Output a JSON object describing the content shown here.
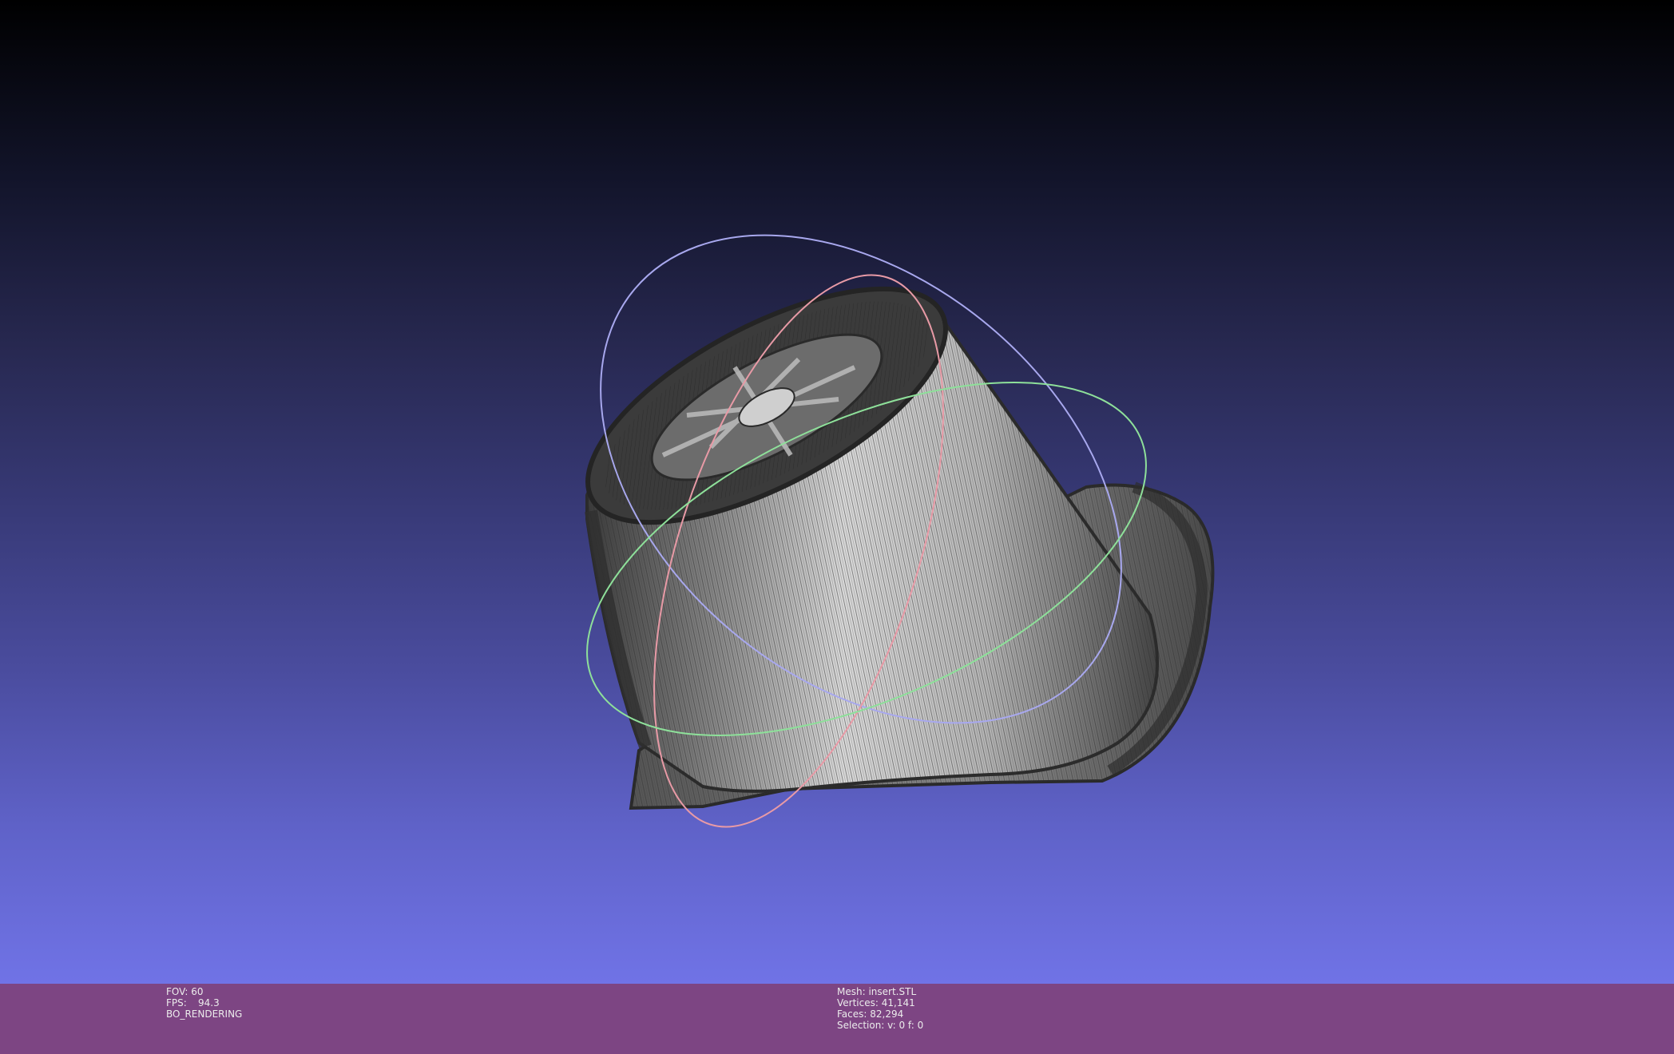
{
  "viewport": {
    "background_top": "#000000",
    "background_bottom": "#7073e6",
    "mesh_color": "#cfcfcf",
    "trackball_colors": {
      "x_axis": "#e89aa6",
      "y_axis": "#8ee09a",
      "z_axis": "#a8a8ee"
    }
  },
  "statusbar": {
    "background": "#7d4583",
    "left": {
      "fov_label": "FOV:",
      "fov_value": "60",
      "fps_label": "FPS:",
      "fps_value": "94.3",
      "render_mode": "BO_RENDERING"
    },
    "center": {
      "mesh_label": "Mesh:",
      "mesh_name": "insert.STL",
      "vertices_label": "Vertices:",
      "vertices_value": "41,141",
      "faces_label": "Faces:",
      "faces_value": "82,294",
      "selection_label": "Selection:",
      "selection_value": "v: 0 f: 0"
    }
  }
}
